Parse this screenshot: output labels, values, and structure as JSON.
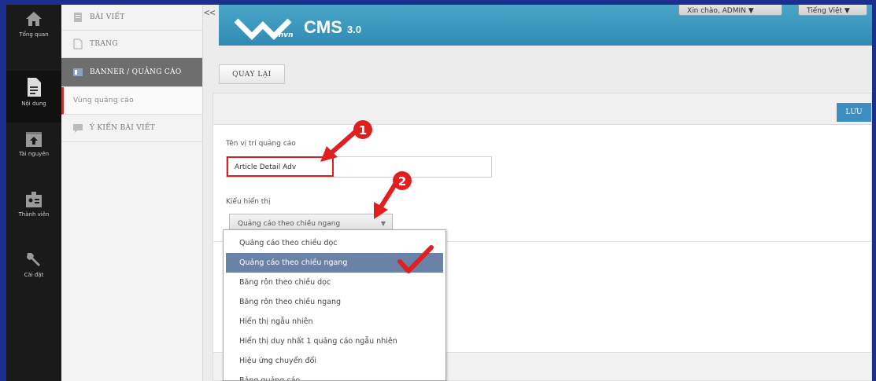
{
  "rail": {
    "items": [
      {
        "label": "Tổng quan",
        "icon": "home-icon"
      },
      {
        "label": "Nội dung",
        "icon": "document-icon"
      },
      {
        "label": "Tài nguyên",
        "icon": "upload-icon"
      },
      {
        "label": "Thành viên",
        "icon": "members-icon"
      },
      {
        "label": "Cài đặt",
        "icon": "wrench-icon"
      }
    ]
  },
  "nav": {
    "items": [
      {
        "label": "BÀI VIẾT",
        "icon": "articles-icon"
      },
      {
        "label": "TRANG",
        "icon": "page-icon"
      },
      {
        "label": "BANNER / QUẢNG CÁO",
        "icon": "banner-icon"
      },
      {
        "label": "Vùng quảng cáo",
        "icon": ""
      },
      {
        "label": "Ý KIẾN BÀI VIẾT",
        "icon": "comment-icon"
      }
    ],
    "collapse_label": "<<"
  },
  "header": {
    "logo_sub": "vnvn",
    "logo_cms": "CMS",
    "logo_version": "3.0",
    "user_menu": "Xin chào, ADMIN",
    "language_menu": "Tiếng Việt"
  },
  "toolbar": {
    "back_label": "QUAY LẠI"
  },
  "panel": {
    "save_label": "LƯU",
    "name_label": "Tên vị trí quảng cáo",
    "name_value": "Article Detail Adv",
    "display_label": "Kiểu hiển thị",
    "display_value": "Quảng cáo theo chiều ngang"
  },
  "dropdown": {
    "options": [
      "Quảng cáo theo chiều dọc",
      "Quảng cáo theo chiều ngang",
      "Băng rôn theo chiều dọc",
      "Băng rôn theo chiều ngang",
      "Hiển thị ngẫu nhiên",
      "Hiển thị duy nhất 1 quảng cáo ngẫu nhiên",
      "Hiệu ứng chuyển đổi",
      "Bảng quảng cáo"
    ],
    "selected_index": 1
  },
  "annotations": {
    "step1": "1",
    "step2": "2"
  },
  "colors": {
    "accent": "#3b8ec2",
    "header": "#2f8bb3",
    "annotation": "#e02020",
    "selected_option": "#6b82a8"
  }
}
